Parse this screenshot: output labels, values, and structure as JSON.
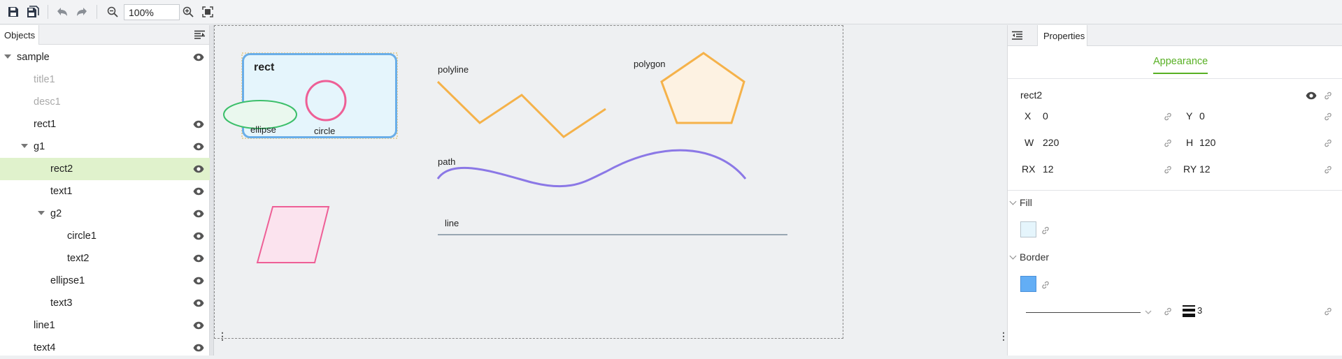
{
  "toolbar": {
    "zoom_value": "100%",
    "icons": [
      "save-icon",
      "save-all-icon",
      "undo-icon",
      "redo-icon",
      "zoom-out-icon",
      "zoom-in-icon",
      "fit-screen-icon"
    ]
  },
  "objects_panel": {
    "tab_label": "Objects",
    "tree": [
      {
        "label": "sample",
        "depth": 0,
        "caret": true,
        "eye": true,
        "dim": false
      },
      {
        "label": "title1",
        "depth": 1,
        "caret": false,
        "eye": false,
        "dim": true
      },
      {
        "label": "desc1",
        "depth": 1,
        "caret": false,
        "eye": false,
        "dim": true
      },
      {
        "label": "rect1",
        "depth": 1,
        "caret": false,
        "eye": true,
        "dim": false
      },
      {
        "label": "g1",
        "depth": 1,
        "caret": true,
        "eye": true,
        "dim": false
      },
      {
        "label": "rect2",
        "depth": 2,
        "caret": false,
        "eye": true,
        "dim": false,
        "selected": true
      },
      {
        "label": "text1",
        "depth": 2,
        "caret": false,
        "eye": true,
        "dim": false
      },
      {
        "label": "g2",
        "depth": 2,
        "caret": true,
        "eye": true,
        "dim": false
      },
      {
        "label": "circle1",
        "depth": 3,
        "caret": false,
        "eye": true,
        "dim": false
      },
      {
        "label": "text2",
        "depth": 3,
        "caret": false,
        "eye": true,
        "dim": false
      },
      {
        "label": "ellipse1",
        "depth": 2,
        "caret": false,
        "eye": true,
        "dim": false
      },
      {
        "label": "text3",
        "depth": 2,
        "caret": false,
        "eye": true,
        "dim": false
      },
      {
        "label": "line1",
        "depth": 1,
        "caret": false,
        "eye": true,
        "dim": false
      },
      {
        "label": "text4",
        "depth": 1,
        "caret": false,
        "eye": true,
        "dim": false
      }
    ]
  },
  "canvas": {
    "labels": {
      "rect": "rect",
      "ellipse": "ellipse",
      "circle": "circle",
      "polyline": "polyline",
      "polygon": "polygon",
      "path": "path",
      "line": "line"
    },
    "colors": {
      "rect_fill": "#e5f5fc",
      "rect_stroke": "#6aaee8",
      "circle_stroke": "#ee5f96",
      "ellipse_stroke": "#3cbf6a",
      "ellipse_fill": "#eaf8ee",
      "polyline_stroke": "#f5b24a",
      "polygon_stroke": "#f5b24a",
      "polygon_fill": "#fdf2e2",
      "path_stroke": "#8b78e6",
      "line_stroke": "#98a6b2",
      "parallelogram_stroke": "#ee5f96",
      "parallelogram_fill": "#fbe3ee"
    }
  },
  "properties_panel": {
    "tab_label": "Properties",
    "subtab_label": "Appearance",
    "object_name": "rect2",
    "fields": {
      "x_label": "X",
      "x_value": "0",
      "y_label": "Y",
      "y_value": "0",
      "w_label": "W",
      "w_value": "220",
      "h_label": "H",
      "h_value": "120",
      "rx_label": "RX",
      "rx_value": "12",
      "ry_label": "RY",
      "ry_value": "12"
    },
    "fill_label": "Fill",
    "fill_color": "#e5f5fc",
    "border_label": "Border",
    "border_color": "#63aef5",
    "stroke_width": "3"
  }
}
